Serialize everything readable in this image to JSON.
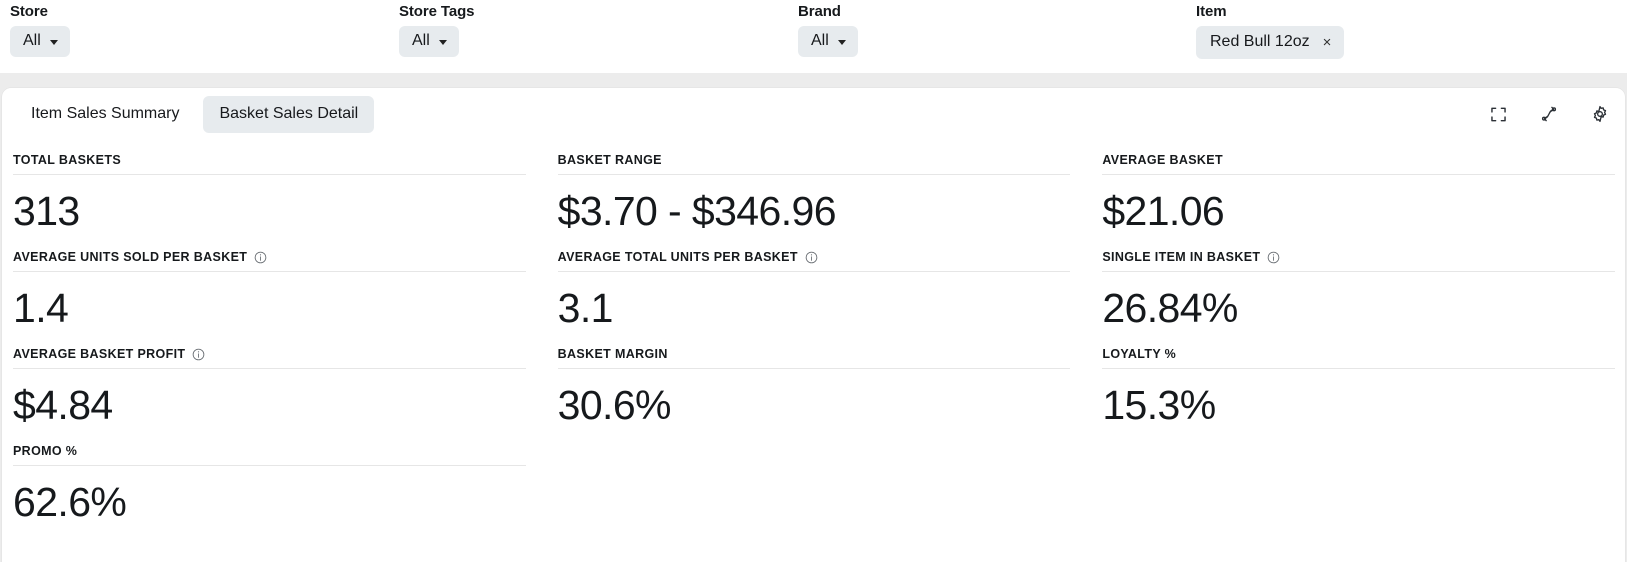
{
  "filters": [
    {
      "label": "Store",
      "type": "dropdown",
      "value": "All",
      "name": "store"
    },
    {
      "label": "Store Tags",
      "type": "dropdown",
      "value": "All",
      "name": "store-tags"
    },
    {
      "label": "Brand",
      "type": "dropdown",
      "value": "All",
      "name": "brand"
    },
    {
      "label": "Item",
      "type": "chip",
      "value": "Red Bull 12oz",
      "remove": "×",
      "name": "item"
    }
  ],
  "tabs": [
    {
      "label": "Item Sales Summary",
      "active": false,
      "name": "item-sales-summary"
    },
    {
      "label": "Basket Sales Detail",
      "active": true,
      "name": "basket-sales-detail"
    }
  ],
  "toolbar": [
    {
      "icon": "fullscreen-icon",
      "name": "fullscreen-button"
    },
    {
      "icon": "refresh-icon",
      "name": "refresh-button"
    },
    {
      "icon": "gear-icon",
      "name": "settings-button"
    }
  ],
  "kpis": [
    {
      "label": "TOTAL BASKETS",
      "value": "313",
      "info": false,
      "name": "total-baskets"
    },
    {
      "label": "BASKET RANGE",
      "value": "$3.70 - $346.96",
      "info": false,
      "name": "basket-range"
    },
    {
      "label": "AVERAGE BASKET",
      "value": "$21.06",
      "info": false,
      "name": "average-basket"
    },
    {
      "label": "AVERAGE UNITS SOLD PER BASKET",
      "value": "1.4",
      "info": true,
      "name": "average-units-sold-per-basket"
    },
    {
      "label": "AVERAGE TOTAL UNITS PER BASKET",
      "value": "3.1",
      "info": true,
      "name": "average-total-units-per-basket"
    },
    {
      "label": "SINGLE ITEM IN BASKET",
      "value": "26.84%",
      "info": true,
      "name": "single-item-in-basket"
    },
    {
      "label": "AVERAGE BASKET PROFIT",
      "value": "$4.84",
      "info": true,
      "name": "average-basket-profit"
    },
    {
      "label": "BASKET MARGIN",
      "value": "30.6%",
      "info": false,
      "name": "basket-margin"
    },
    {
      "label": "LOYALTY %",
      "value": "15.3%",
      "info": false,
      "name": "loyalty-percent"
    },
    {
      "label": "PROMO %",
      "value": "62.6%",
      "info": false,
      "name": "promo-percent"
    }
  ],
  "colors": {
    "page_background": "#ececec",
    "card_background": "#ffffff",
    "control_background": "#e7ebee",
    "text": "#16191c",
    "divider": "#e6e6e6"
  }
}
